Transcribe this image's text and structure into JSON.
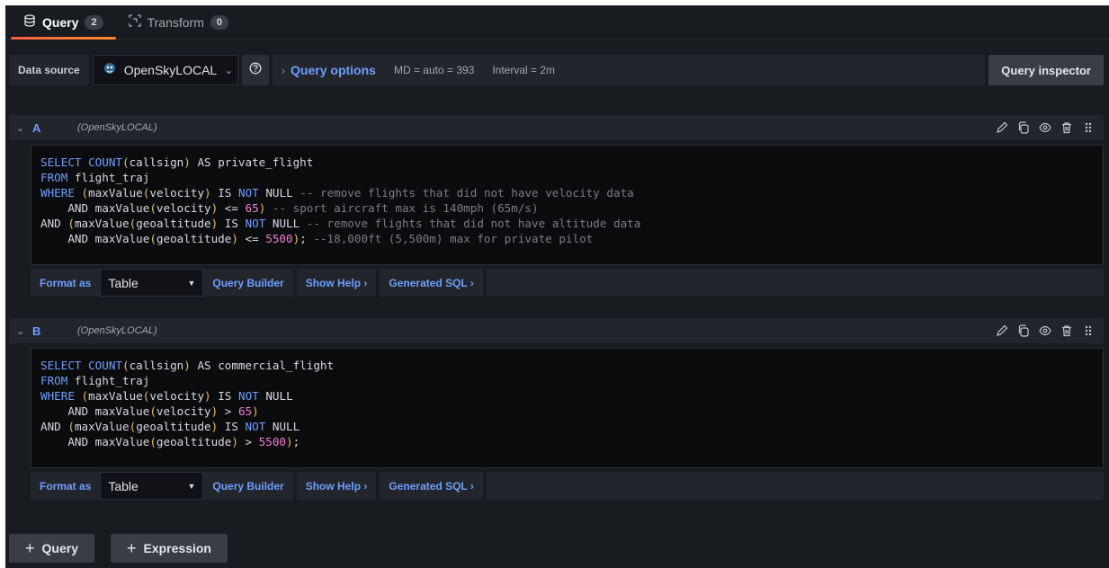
{
  "tabs": [
    {
      "label": "Query",
      "count": "2",
      "active": true
    },
    {
      "label": "Transform",
      "count": "0",
      "active": false
    }
  ],
  "toolbar": {
    "datasource_label": "Data source",
    "datasource_value": "OpenSkyLOCAL",
    "query_options_label": "Query options",
    "md_info": "MD = auto = 393",
    "interval_info": "Interval = 2m",
    "inspector_label": "Query inspector"
  },
  "queries": [
    {
      "ref_id": "A",
      "datasource": "(OpenSkyLOCAL)",
      "format_label": "Format as",
      "format_value": "Table",
      "query_builder": "Query Builder",
      "show_help": "Show Help ›",
      "generated_sql": "Generated SQL ›",
      "lines": [
        [
          {
            "t": "SELECT ",
            "c": "kw"
          },
          {
            "t": "COUNT",
            "c": "kw"
          },
          {
            "t": "(",
            "c": "par"
          },
          {
            "t": "callsign",
            "c": ""
          },
          {
            "t": ")",
            "c": "par"
          },
          {
            "t": " AS private_flight",
            "c": ""
          }
        ],
        [
          {
            "t": "FROM",
            "c": "kw"
          },
          {
            "t": " flight_traj",
            "c": ""
          }
        ],
        [
          {
            "t": "WHERE",
            "c": "kw"
          },
          {
            "t": " ",
            "c": ""
          },
          {
            "t": "(",
            "c": "par"
          },
          {
            "t": "maxValue",
            "c": ""
          },
          {
            "t": "(",
            "c": "par"
          },
          {
            "t": "velocity",
            "c": ""
          },
          {
            "t": ")",
            "c": "par"
          },
          {
            "t": " IS ",
            "c": ""
          },
          {
            "t": "NOT",
            "c": "kw"
          },
          {
            "t": " NULL ",
            "c": ""
          },
          {
            "t": "-- remove flights that did not have velocity data",
            "c": "cm"
          }
        ],
        [
          {
            "t": "    AND maxValue",
            "c": ""
          },
          {
            "t": "(",
            "c": "par"
          },
          {
            "t": "velocity",
            "c": ""
          },
          {
            "t": ")",
            "c": "par"
          },
          {
            "t": " <= ",
            "c": ""
          },
          {
            "t": "65",
            "c": "num"
          },
          {
            "t": ")",
            "c": "par"
          },
          {
            "t": " -- sport aircraft max is 140mph (65m/s)",
            "c": "cm"
          }
        ],
        [
          {
            "t": "AND ",
            "c": ""
          },
          {
            "t": "(",
            "c": "par"
          },
          {
            "t": "maxValue",
            "c": ""
          },
          {
            "t": "(",
            "c": "par"
          },
          {
            "t": "geoaltitude",
            "c": ""
          },
          {
            "t": ")",
            "c": "par"
          },
          {
            "t": " IS ",
            "c": ""
          },
          {
            "t": "NOT",
            "c": "kw"
          },
          {
            "t": " NULL ",
            "c": ""
          },
          {
            "t": "-- remove flights that did not have altitude data",
            "c": "cm"
          }
        ],
        [
          {
            "t": "    AND maxValue",
            "c": ""
          },
          {
            "t": "(",
            "c": "par"
          },
          {
            "t": "geoaltitude",
            "c": ""
          },
          {
            "t": ")",
            "c": "par"
          },
          {
            "t": " <= ",
            "c": ""
          },
          {
            "t": "5500",
            "c": "num"
          },
          {
            "t": ")",
            "c": "par"
          },
          {
            "t": "; ",
            "c": ""
          },
          {
            "t": "--18,000ft (5,500m) max for private pilot",
            "c": "cm"
          }
        ]
      ]
    },
    {
      "ref_id": "B",
      "datasource": "(OpenSkyLOCAL)",
      "format_label": "Format as",
      "format_value": "Table",
      "query_builder": "Query Builder",
      "show_help": "Show Help ›",
      "generated_sql": "Generated SQL ›",
      "lines": [
        [
          {
            "t": "SELECT ",
            "c": "kw"
          },
          {
            "t": "COUNT",
            "c": "kw"
          },
          {
            "t": "(",
            "c": "par"
          },
          {
            "t": "callsign",
            "c": ""
          },
          {
            "t": ")",
            "c": "par"
          },
          {
            "t": " AS commercial_flight",
            "c": ""
          }
        ],
        [
          {
            "t": "FROM",
            "c": "kw"
          },
          {
            "t": " flight_traj",
            "c": ""
          }
        ],
        [
          {
            "t": "WHERE",
            "c": "kw"
          },
          {
            "t": " ",
            "c": ""
          },
          {
            "t": "(",
            "c": "par"
          },
          {
            "t": "maxValue",
            "c": ""
          },
          {
            "t": "(",
            "c": "par"
          },
          {
            "t": "velocity",
            "c": ""
          },
          {
            "t": ")",
            "c": "par"
          },
          {
            "t": " IS ",
            "c": ""
          },
          {
            "t": "NOT",
            "c": "kw"
          },
          {
            "t": " NULL",
            "c": ""
          }
        ],
        [
          {
            "t": "    AND maxValue",
            "c": ""
          },
          {
            "t": "(",
            "c": "par"
          },
          {
            "t": "velocity",
            "c": ""
          },
          {
            "t": ")",
            "c": "par"
          },
          {
            "t": " > ",
            "c": ""
          },
          {
            "t": "65",
            "c": "num"
          },
          {
            "t": ")",
            "c": "par"
          }
        ],
        [
          {
            "t": "AND ",
            "c": ""
          },
          {
            "t": "(",
            "c": "par"
          },
          {
            "t": "maxValue",
            "c": ""
          },
          {
            "t": "(",
            "c": "par"
          },
          {
            "t": "geoaltitude",
            "c": ""
          },
          {
            "t": ")",
            "c": "par"
          },
          {
            "t": " IS ",
            "c": ""
          },
          {
            "t": "NOT",
            "c": "kw"
          },
          {
            "t": " NULL",
            "c": ""
          }
        ],
        [
          {
            "t": "    AND maxValue",
            "c": ""
          },
          {
            "t": "(",
            "c": "par"
          },
          {
            "t": "geoaltitude",
            "c": ""
          },
          {
            "t": ")",
            "c": "par"
          },
          {
            "t": " > ",
            "c": ""
          },
          {
            "t": "5500",
            "c": "num"
          },
          {
            "t": ")",
            "c": "par"
          },
          {
            "t": ";",
            "c": ""
          }
        ]
      ]
    }
  ],
  "add_buttons": {
    "query_label": "Query",
    "expression_label": "Expression"
  }
}
